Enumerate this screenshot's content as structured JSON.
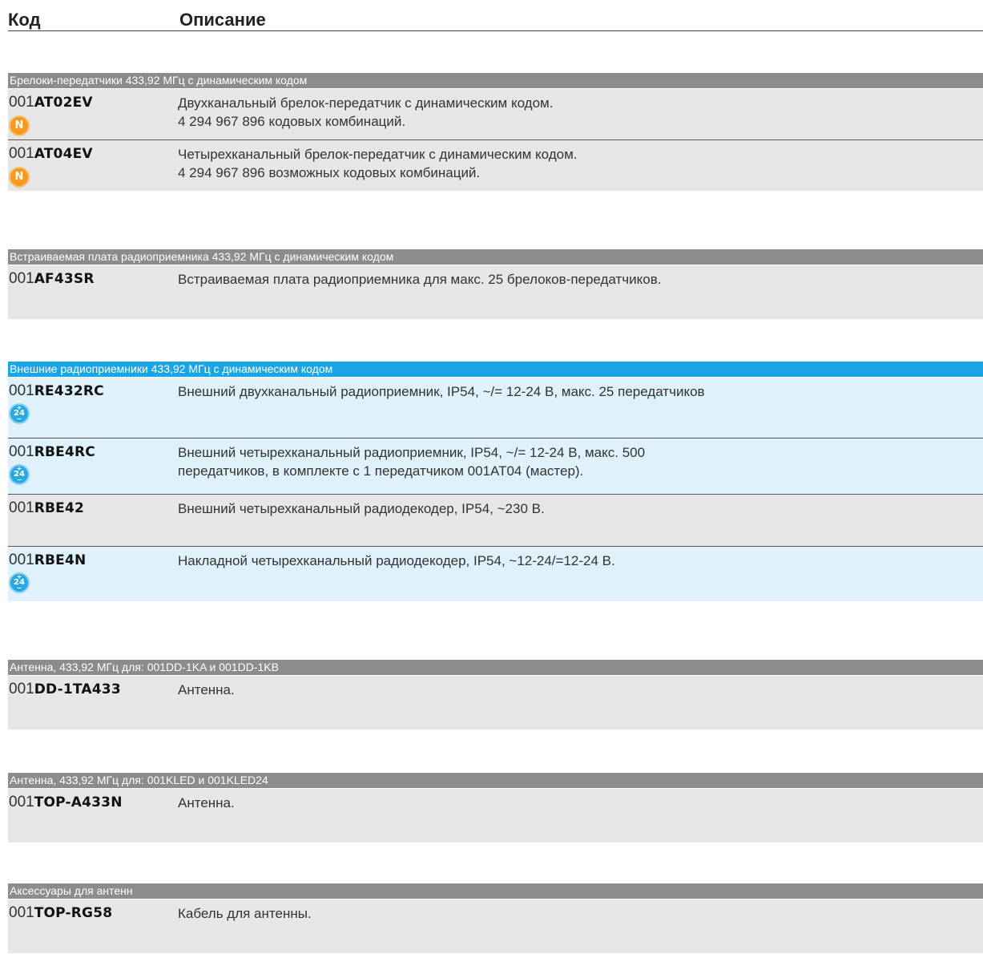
{
  "header": {
    "code": "Код",
    "description": "Описание"
  },
  "sections": [
    {
      "title": "Брелоки-передатчики 433,92 МГц с динамическим кодом",
      "rows": [
        {
          "prefix": "001",
          "code": "AT02EV",
          "line1": "Двухканальный брелок-передатчик с динамическим кодом.",
          "line2": "4 294 967 896 кодовых комбинаций.",
          "badge": "N"
        },
        {
          "prefix": "001",
          "code": "AT04EV",
          "line1": "Четырехканальный брелок-передатчик с динамическим кодом.",
          "line2": "4 294 967 896 возможных кодовых комбинаций.",
          "badge": "N"
        }
      ]
    },
    {
      "title": "Встраиваемая плата радиоприемника 433,92 МГц с динамическим кодом",
      "rows": [
        {
          "prefix": "001",
          "code": "AF43SR",
          "line1": "Встраиваемая плата радиоприемника для макс. 25 брелоков-передатчиков."
        }
      ]
    },
    {
      "title": "Внешние радиоприемники 433,92 МГц с динамическим кодом",
      "rows": [
        {
          "prefix": "001",
          "code": "RE432RC",
          "line1": "Внешний двухканальный радиоприемник, IP54, ~/= 12-24 В, макс. 25 передатчиков",
          "badge": "24"
        },
        {
          "prefix": "001",
          "code": "RBE4RC",
          "line1": "Внешний четырехканальный радиоприемник, IP54, ~/= 12-24 В, макс. 500",
          "line2": "передатчиков, в комплекте с 1 передатчиком 001AT04 (мастер).",
          "badge": "24"
        },
        {
          "prefix": "001",
          "code": "RBE42",
          "line1": "Внешний четырехканальный радиодекодер, IP54, ~230 В."
        },
        {
          "prefix": "001",
          "code": "RBE4N",
          "line1": "Накладной четырехканальный радиодекодер, IP54, ~12-24/=12-24 В.",
          "badge": "24"
        }
      ]
    },
    {
      "title": "Антенна, 433,92 МГц для: 001DD-1KA и 001DD-1KB",
      "rows": [
        {
          "prefix": "001",
          "code": "DD-1TA433",
          "line1": "Антенна."
        }
      ]
    },
    {
      "title": "Антенна, 433,92 МГц для: 001KLED и 001KLED24",
      "rows": [
        {
          "prefix": "001",
          "code": "TOP-A433N",
          "line1": "Антенна."
        }
      ]
    },
    {
      "title": "Аксессуары для антенн",
      "rows": [
        {
          "prefix": "001",
          "code": "TOP-RG58",
          "line1": "Кабель для антенны."
        }
      ]
    }
  ],
  "badge_plus": "+",
  "badge_minus": "−"
}
